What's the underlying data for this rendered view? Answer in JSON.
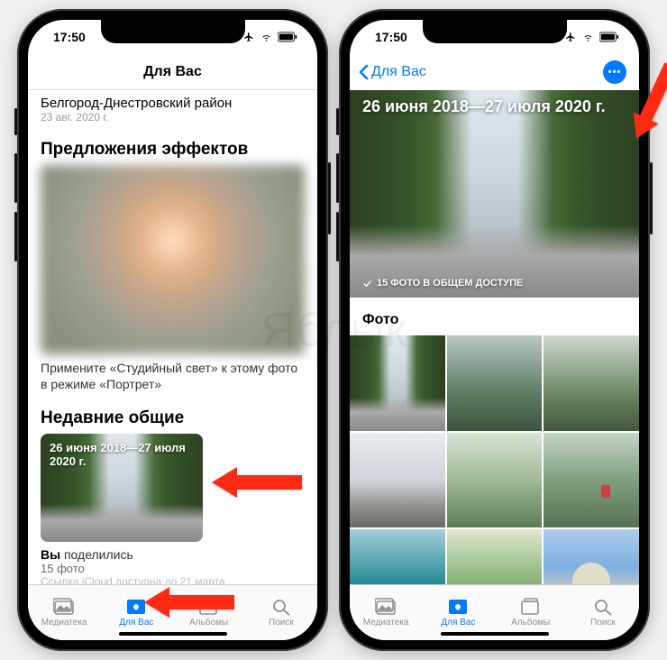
{
  "status": {
    "time": "17:50"
  },
  "left": {
    "nav_title": "Для Вас",
    "location_title": "Белгород-Днестровский район",
    "location_date": "23 авг. 2020 г.",
    "effects_heading": "Предложения эффектов",
    "effects_caption": "Примените «Студийный свет» к этому фото в режиме «Портрет»",
    "recent_heading": "Недавние общие",
    "recent_card_title": "26 июня 2018—27 июля 2020 г.",
    "shared_you": "Вы",
    "shared_rest": " поделились",
    "shared_count": "15 фото",
    "shared_link": "Ссылка iCloud доступна до 21 марта"
  },
  "right": {
    "back_label": "Для Вас",
    "hero_title": "26 июня 2018—27 июля 2020 г.",
    "hero_badge": "15 ФОТО В ОБЩЕМ ДОСТУПЕ",
    "photos_heading": "Фото"
  },
  "tabs": {
    "library": "Медиатека",
    "for_you": "Для Вас",
    "albums": "Альбомы",
    "search": "Поиск"
  },
  "watermark": "Яблык"
}
